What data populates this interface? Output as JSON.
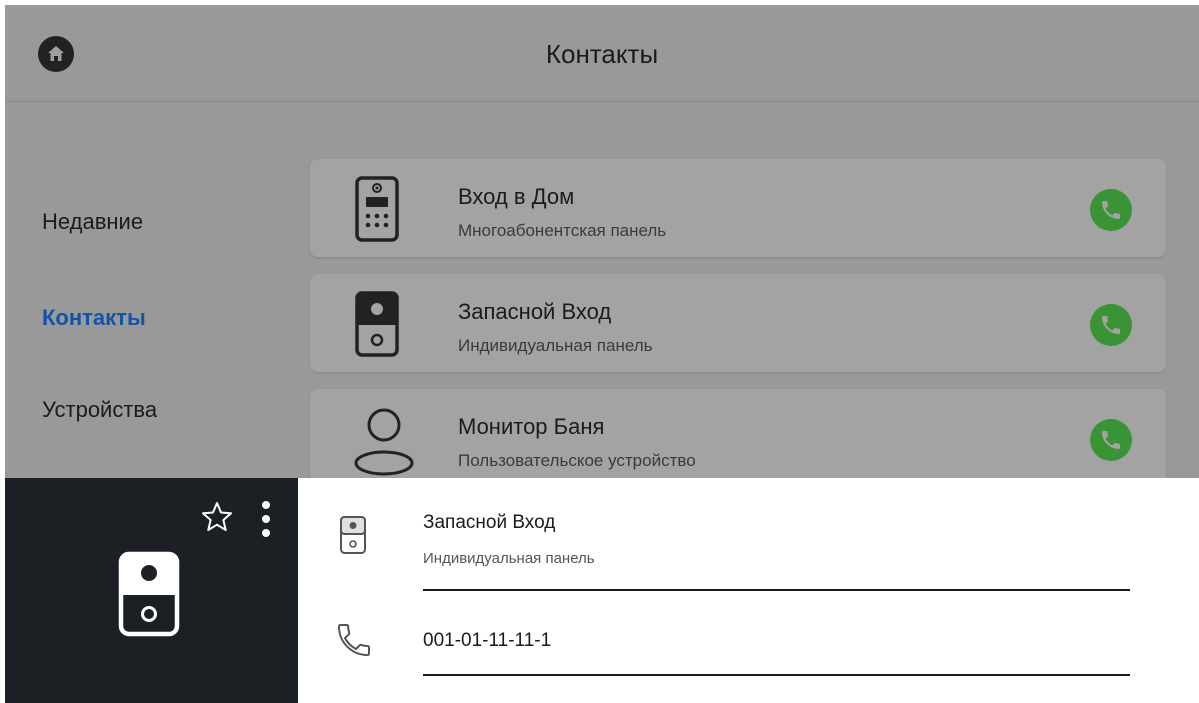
{
  "header": {
    "title": "Контакты",
    "home_icon": "home-icon"
  },
  "sidebar": {
    "items": [
      {
        "label": "Недавние",
        "active": false
      },
      {
        "label": "Контакты",
        "active": true
      },
      {
        "label": "Устройства",
        "active": false
      }
    ],
    "active_color": "#1553a7"
  },
  "contacts": [
    {
      "name": "Вход в Дом",
      "type": "Многоабонентская панель",
      "icon": "multi-apartment-panel-icon"
    },
    {
      "name": "Запасной Вход",
      "type": "Индивидуальная панель",
      "icon": "individual-panel-icon"
    },
    {
      "name": "Монитор Баня",
      "type": "Пользовательское устройство",
      "icon": "user-device-icon"
    }
  ],
  "call_color": "#3a9334",
  "detail": {
    "name": "Запасной Вход",
    "type": "Индивидуальная панель",
    "number": "001-01-11-11-1",
    "favorite_icon": "star-outline-icon",
    "menu_icon": "more-vertical-icon",
    "device_icon": "individual-panel-icon",
    "phone_icon": "phone-outline-icon"
  }
}
